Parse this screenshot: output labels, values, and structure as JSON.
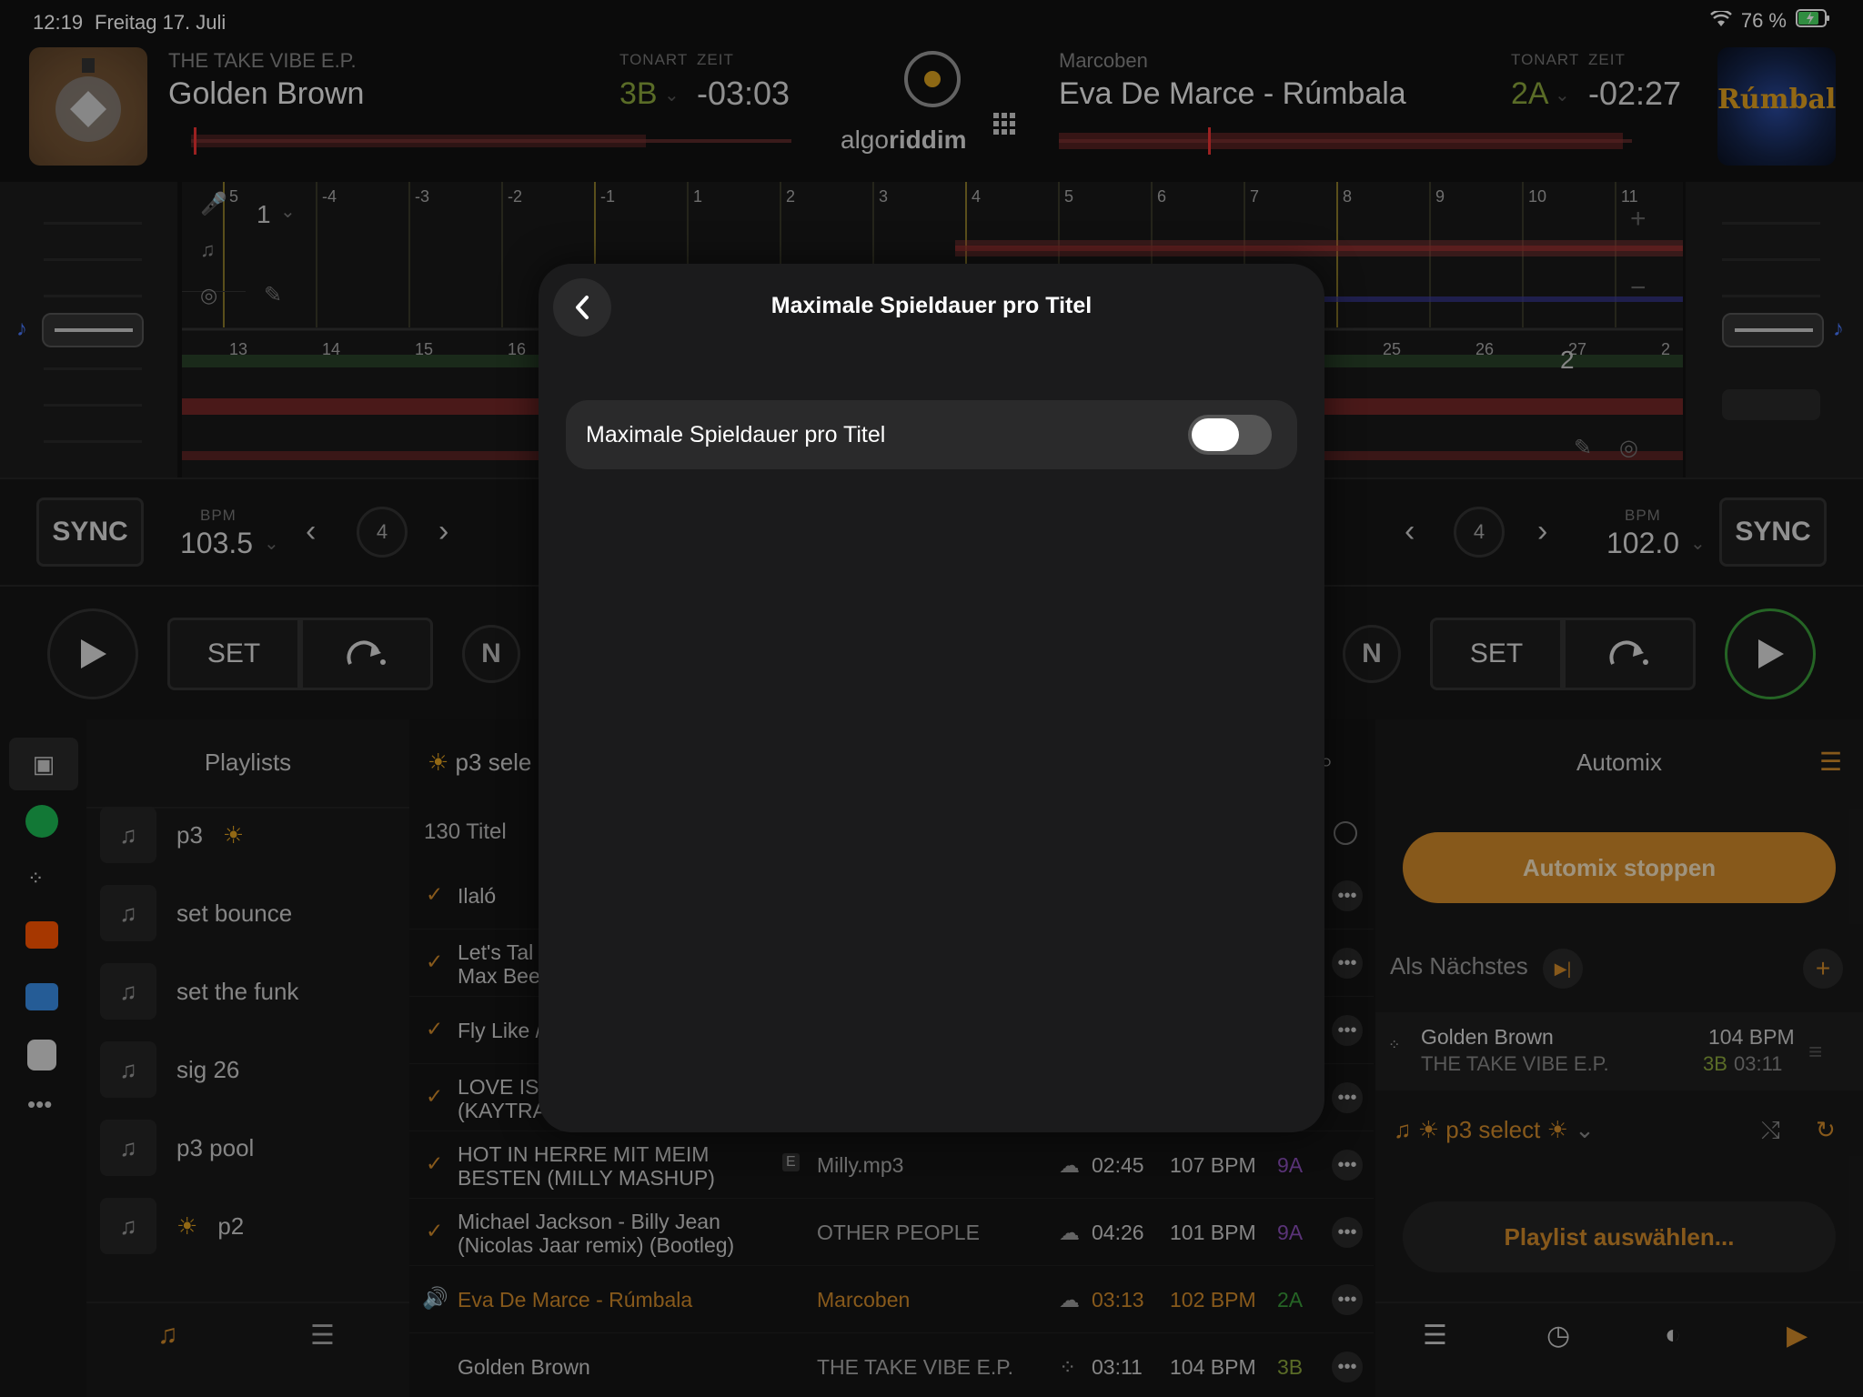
{
  "status": {
    "time": "12:19",
    "date": "Freitag 17. Juli",
    "battery": "76 %"
  },
  "deck_left": {
    "artist": "THE TAKE VIBE E.P.",
    "title": "Golden Brown",
    "key_label": "TONART",
    "time_label": "ZEIT",
    "key": "3B",
    "time": "-03:03",
    "sync": "SYNC",
    "bpm_label": "BPM",
    "bpm": "103.5",
    "loop": "4",
    "set": "SET",
    "beat_marker": "1",
    "beats_top": [
      "5",
      "-4",
      "-3",
      "-2",
      "-1",
      "1",
      "2",
      "3",
      "4",
      "5",
      "6",
      "7",
      "8",
      "9",
      "10",
      "11"
    ],
    "beats_bottom": [
      "13",
      "14",
      "15",
      "16"
    ]
  },
  "deck_right": {
    "artist": "Marcoben",
    "title": "Eva De Marce - Rúmbala",
    "key_label": "TONART",
    "time_label": "ZEIT",
    "key": "2A",
    "time": "-02:27",
    "sync": "SYNC",
    "bpm_label": "BPM",
    "bpm": "102.0",
    "loop": "4",
    "set": "SET",
    "cover_text": "Rúmbala",
    "beat_marker": "2",
    "beats_bottom": [
      "25",
      "26",
      "27",
      "2"
    ]
  },
  "logo": {
    "text_light": "algo",
    "text_bold": "riddim"
  },
  "library": {
    "playlists_title": "Playlists",
    "playlists": [
      {
        "label": "p3",
        "sun": true,
        "sun_before": false
      },
      {
        "label": "set bounce"
      },
      {
        "label": "set the funk"
      },
      {
        "label": "sig 26"
      },
      {
        "label": "p3 pool"
      },
      {
        "label": "p2",
        "sun": true,
        "sun_before": true
      }
    ],
    "current_title": "p3 sele",
    "count": "130 Titel",
    "tracks": [
      {
        "title": "Ilaló",
        "artist": "",
        "dur": "",
        "bpm": "",
        "key": ""
      },
      {
        "title": "Let's Tal",
        "title2": "Max Bee",
        "artist": "",
        "dur": "",
        "bpm": "",
        "key": ""
      },
      {
        "title": "Fly Like /",
        "artist": "",
        "dur": "",
        "bpm": "",
        "key": ""
      },
      {
        "title": "LOVE IS",
        "title2": "(KAYTRA",
        "artist": "",
        "dur": "",
        "bpm": "",
        "key": ""
      },
      {
        "title": "HOT IN HERRE MIT MEIM",
        "title2": "BESTEN (MILLY MASHUP)",
        "explicit": "E",
        "artist": "Milly.mp3",
        "dur": "02:45",
        "bpm": "107 BPM",
        "key": "9A"
      },
      {
        "title": "Michael Jackson - Billy Jean",
        "title2": "(Nicolas Jaar remix) (Bootleg)",
        "artist": "OTHER PEOPLE",
        "dur": "04:26",
        "bpm": "101 BPM",
        "key": "9A"
      },
      {
        "title": "Eva De Marce - Rúmbala",
        "artist": "Marcoben",
        "dur": "03:13",
        "bpm": "102 BPM",
        "key": "2A",
        "playing": true
      },
      {
        "title": "Golden Brown",
        "artist": "THE TAKE VIBE E.P.",
        "dur": "03:11",
        "bpm": "104 BPM",
        "key": "3B"
      }
    ]
  },
  "automix": {
    "title": "Automix",
    "stop_button": "Automix stoppen",
    "next_label": "Als Nächstes",
    "next_track": {
      "title": "Golden Brown",
      "artist": "THE TAKE VIBE E.P.",
      "bpm": "104 BPM",
      "key": "3B",
      "dur": "03:11"
    },
    "playlist_name": "p3 select",
    "choose_playlist": "Playlist auswählen..."
  },
  "modal": {
    "title": "Maximale Spieldauer pro Titel",
    "row_label": "Maximale Spieldauer pro Titel",
    "toggle_on": false
  },
  "colors": {
    "accent": "#d0892a",
    "key_green": "#8aa63c",
    "key_purple": "#8a4fb8",
    "play_green": "#3a9a3a"
  }
}
